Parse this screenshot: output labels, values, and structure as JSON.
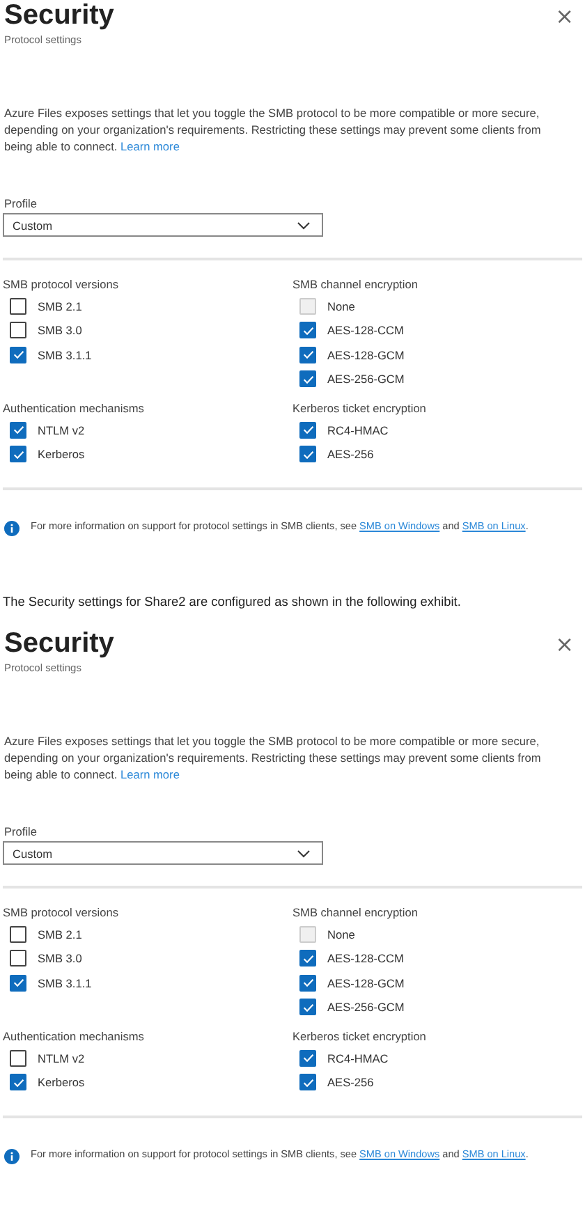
{
  "sections": [
    {
      "kind": "panel",
      "title": "Security",
      "subtitle": "Protocol settings",
      "close": "×",
      "description": "Azure Files exposes settings that let you toggle the SMB protocol to be more compatible or more secure, depending on your organization's requirements. Restricting these settings may prevent some clients from being able to connect. ",
      "learn_more": "Learn more",
      "profile": {
        "label": "Profile",
        "value": "Custom"
      },
      "groups": [
        {
          "title": "SMB protocol versions",
          "options": [
            {
              "label": "SMB 2.1",
              "checked": false,
              "disabled": false
            },
            {
              "label": "SMB 3.0",
              "checked": false,
              "disabled": false
            },
            {
              "label": "SMB 3.1.1",
              "checked": true,
              "disabled": false
            }
          ]
        },
        {
          "title": "SMB channel encryption",
          "options": [
            {
              "label": "None",
              "checked": false,
              "disabled": true
            },
            {
              "label": "AES-128-CCM",
              "checked": true,
              "disabled": false
            },
            {
              "label": "AES-128-GCM",
              "checked": true,
              "disabled": false
            },
            {
              "label": "AES-256-GCM",
              "checked": true,
              "disabled": false
            }
          ]
        },
        {
          "title": "Authentication mechanisms",
          "options": [
            {
              "label": "NTLM v2",
              "checked": true,
              "disabled": false
            },
            {
              "label": "Kerberos",
              "checked": true,
              "disabled": false
            }
          ]
        },
        {
          "title": "Kerberos ticket encryption",
          "options": [
            {
              "label": "RC4-HMAC",
              "checked": true,
              "disabled": false
            },
            {
              "label": "AES-256",
              "checked": true,
              "disabled": false
            }
          ]
        }
      ],
      "info": {
        "text": "For more information on support for protocol settings in SMB clients, see ",
        "link1": "SMB on Windows",
        "middle": " and ",
        "link2": "SMB on Linux",
        "end": "."
      }
    },
    {
      "kind": "caption",
      "text": "The Security settings for Share2 are configured as shown in the following exhibit."
    },
    {
      "kind": "panel",
      "title": "Security",
      "subtitle": "Protocol settings",
      "close": "×",
      "description": "Azure Files exposes settings that let you toggle the SMB protocol to be more compatible or more secure, depending on your organization's requirements. Restricting these settings may prevent some clients from being able to connect. ",
      "learn_more": "Learn more",
      "profile": {
        "label": "Profile",
        "value": "Custom"
      },
      "groups": [
        {
          "title": "SMB protocol versions",
          "options": [
            {
              "label": "SMB 2.1",
              "checked": false,
              "disabled": false
            },
            {
              "label": "SMB 3.0",
              "checked": false,
              "disabled": false
            },
            {
              "label": "SMB 3.1.1",
              "checked": true,
              "disabled": false
            }
          ]
        },
        {
          "title": "SMB channel encryption",
          "options": [
            {
              "label": "None",
              "checked": false,
              "disabled": true
            },
            {
              "label": "AES-128-CCM",
              "checked": true,
              "disabled": false
            },
            {
              "label": "AES-128-GCM",
              "checked": true,
              "disabled": false
            },
            {
              "label": "AES-256-GCM",
              "checked": true,
              "disabled": false
            }
          ]
        },
        {
          "title": "Authentication mechanisms",
          "options": [
            {
              "label": "NTLM v2",
              "checked": false,
              "disabled": false
            },
            {
              "label": "Kerberos",
              "checked": true,
              "disabled": false
            }
          ]
        },
        {
          "title": "Kerberos ticket encryption",
          "options": [
            {
              "label": "RC4-HMAC",
              "checked": true,
              "disabled": false
            },
            {
              "label": "AES-256",
              "checked": true,
              "disabled": false
            }
          ]
        }
      ],
      "info": {
        "text": "For more information on support for protocol settings in SMB clients, see ",
        "link1": "SMB on Windows",
        "middle": " and ",
        "link2": "SMB on Linux",
        "end": "."
      }
    }
  ]
}
